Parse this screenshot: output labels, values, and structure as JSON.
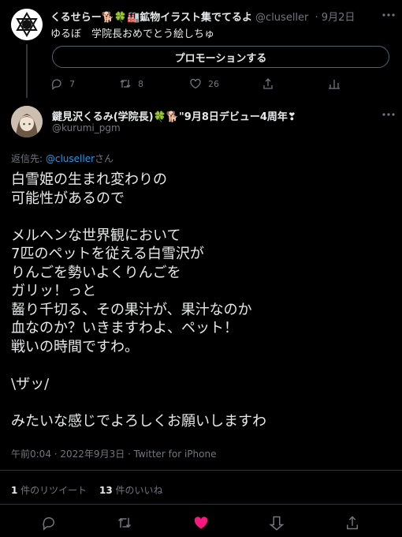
{
  "colors": {
    "background": "#000000",
    "text": "#e7e9ea",
    "muted": "#71767b",
    "link": "#1d9bf0",
    "like": "#f91880"
  },
  "tweet1": {
    "name": "くるせらー🐕🍀🏭鉱物イラスト集でてるよ",
    "handle": "@cluseller",
    "date": "· 9月2日",
    "text": "ゆるぼ　学院長おめでとう絵しちゅ",
    "promote_label": "プロモーションする",
    "reply_count": "7",
    "retweet_count": "8",
    "like_count": "26",
    "icons": [
      "reply-icon",
      "retweet-icon",
      "like-icon",
      "share-icon",
      "analytics-icon",
      "more-icon"
    ]
  },
  "tweet2": {
    "name": "鍵見沢くるみ(学院長)🍀🐕\"9月8日デビュー4周年❣",
    "handle": "@kurumi_pgm",
    "reply_prefix": "返信先: ",
    "reply_user": "@cluseller",
    "reply_suffix": "さん",
    "body": "白雪姫の生まれ変わりの\n可能性があるので\n\nメルヘンな世界観において\n7匹のペットを従える白雪沢が\nりんごを勢いよくりんごを\nガリッ！っと\n齧り千切る、その果汁が、果汁なのか\n血なのか？いきますわよ、ペット！\n戦いの時間ですわ。\n\n\\ザッ/\n\nみたいな感じでよろしくお願いしますわ",
    "timestamp": "午前0:04 · 2022年9月3日 · Twitter for iPhone",
    "retweet_count": "1",
    "retweet_label": " 件のリツイート",
    "like_count": "13",
    "like_label": " 件のいいね",
    "icons": [
      "reply-icon",
      "retweet-icon",
      "like-icon-filled",
      "bookmark-icon",
      "share-icon"
    ]
  }
}
